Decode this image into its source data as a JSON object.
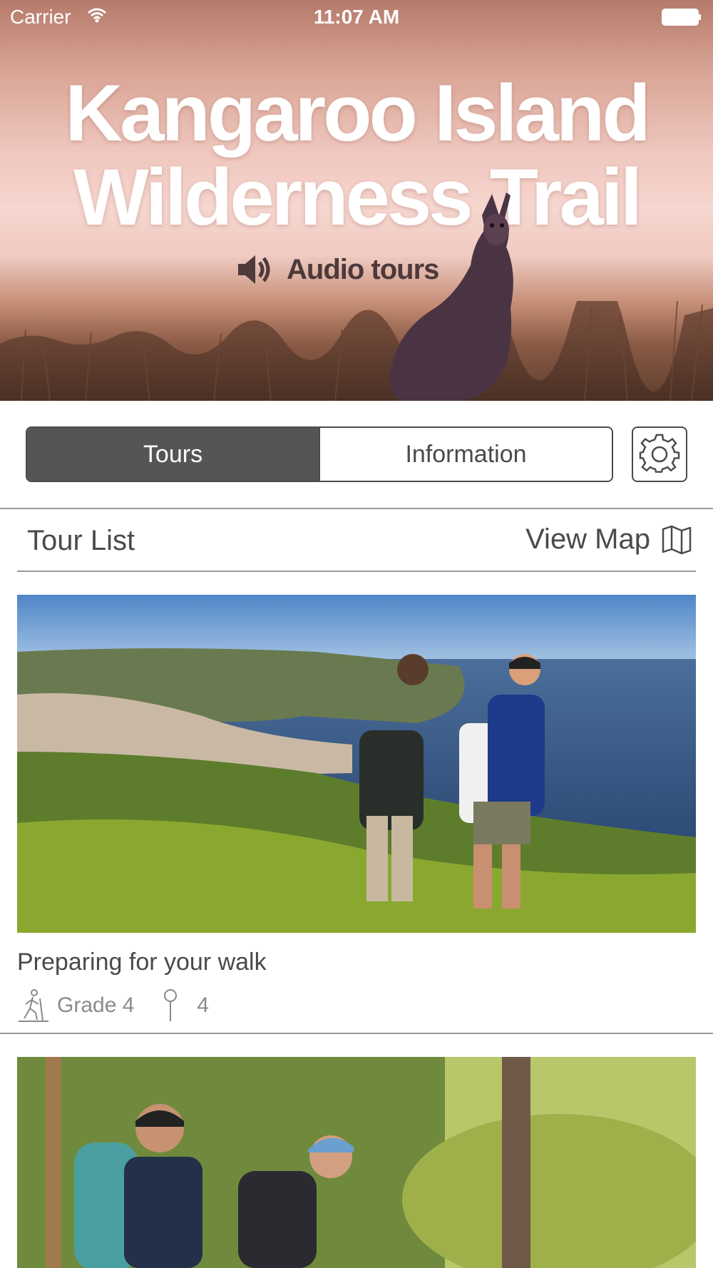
{
  "status_bar": {
    "carrier": "Carrier",
    "time": "11:07 AM"
  },
  "hero": {
    "title_line1": "Kangaroo Island",
    "title_line2": "Wilderness Trail",
    "subtitle": "Audio tours"
  },
  "tabs": [
    {
      "label": "Tours",
      "active": true
    },
    {
      "label": "Information",
      "active": false
    }
  ],
  "tour_list": {
    "title": "Tour List",
    "view_map_label": "View Map"
  },
  "tours": [
    {
      "title": "Preparing for your walk",
      "grade": "Grade 4",
      "stops": "4"
    }
  ],
  "colors": {
    "active_tab": "#555555",
    "text": "#4a4a4a",
    "meta_text": "#8a8a8a",
    "divider": "#9a9a9a"
  }
}
